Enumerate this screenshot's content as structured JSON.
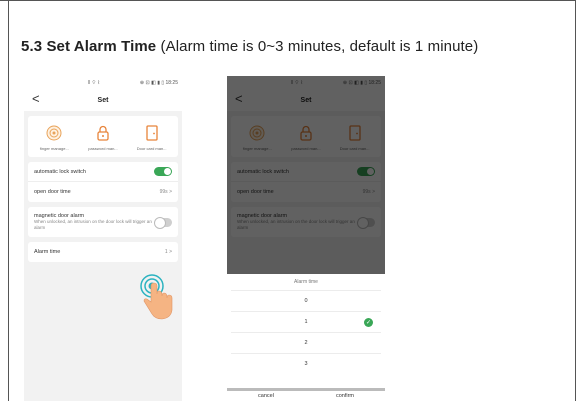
{
  "heading": {
    "number": "5.3",
    "bold_text": "Set Alarm Time",
    "note": "(Alarm time is 0~3 minutes, default is 1 minute)"
  },
  "phone_common": {
    "status_left": "ǁ ⌔ ⌇ ",
    "status_right": "⊕ ⊡ ◧ ▮ ▯ 18:25",
    "back": "<",
    "title": "Set",
    "icons": [
      {
        "name": "fingerprint-icon",
        "label": "finger manage..."
      },
      {
        "name": "lock-icon",
        "label": "password man..."
      },
      {
        "name": "door-card-icon",
        "label": "Door card man..."
      }
    ],
    "auto_lock_label": "automatic lock switch",
    "open_door_label": "open door time",
    "open_door_value": "99s >",
    "mag_alarm_label": "magnetic door alarm",
    "mag_alarm_desc": "When unlocked, an intrusion on the door lock will trigger an alarm",
    "alarm_time_label": "Alarm time",
    "alarm_time_value": "1 >"
  },
  "picker": {
    "title": "Alarm time",
    "options": [
      "0",
      "1",
      "2",
      "3"
    ],
    "selected_index": 1,
    "cancel": "cancel",
    "confirm": "confirm"
  },
  "colors": {
    "accent_green": "#3aa757",
    "overlay": "#000000"
  }
}
